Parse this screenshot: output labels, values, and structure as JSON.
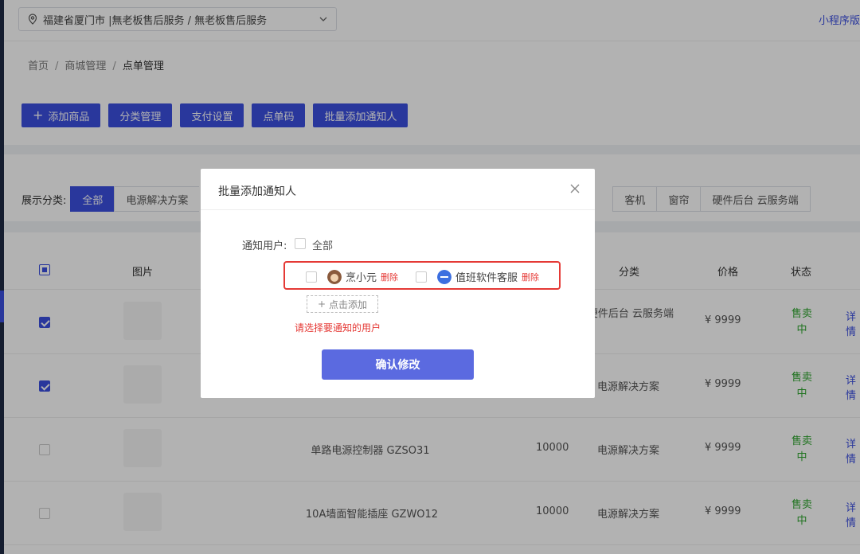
{
  "topbar": {
    "location": "福建省厦门市 |無老板售后服务 / 無老板售后服务",
    "mini_program_link": "小程序版"
  },
  "breadcrumb": [
    "首页",
    "商城管理",
    "点单管理"
  ],
  "breadcrumb_sep": "/",
  "toolbar": {
    "add_product": "添加商品",
    "category_manage": "分类管理",
    "payment_settings": "支付设置",
    "order_code": "点单码",
    "batch_add_notify": "批量添加通知人"
  },
  "filter": {
    "label": "展示分类:",
    "segments": [
      "全部",
      "电源解决方案",
      "",
      "",
      "客机",
      "窗帘",
      "硬件后台 云服务端"
    ]
  },
  "table": {
    "headers": {
      "image": "图片",
      "category": "分类",
      "price": "价格",
      "status": "状态"
    },
    "rows": [
      {
        "name": "",
        "stock": "",
        "category": "硬件后台 云服务端",
        "price": "¥ 9999",
        "status": "售卖中",
        "detail": "详情",
        "checked": true
      },
      {
        "name": "",
        "stock": "",
        "category": "电源解决方案",
        "price": "¥ 9999",
        "status": "售卖中",
        "detail": "详情",
        "checked": true
      },
      {
        "name": "单路电源控制器 GZSO31",
        "stock": "10000",
        "category": "电源解决方案",
        "price": "¥ 9999",
        "status": "售卖中",
        "detail": "详情",
        "checked": false
      },
      {
        "name": "10A墙面智能插座 GZWO12",
        "stock": "10000",
        "category": "电源解决方案",
        "price": "¥ 9999",
        "status": "售卖中",
        "detail": "详情",
        "checked": false
      }
    ]
  },
  "modal": {
    "title": "批量添加通知人",
    "field_label": "通知用户:",
    "select_all": "全部",
    "users": [
      {
        "name": "烹小元",
        "delete": "删除"
      },
      {
        "name": "值班软件客服",
        "delete": "删除"
      }
    ],
    "add_button": "点击添加",
    "error": "请选择要通知的用户",
    "confirm": "确认修改"
  },
  "colors": {
    "primary": "#3c4fe0",
    "confirm": "#5b6ae0",
    "danger": "#e53935",
    "on_sale": "#2fa52f"
  }
}
